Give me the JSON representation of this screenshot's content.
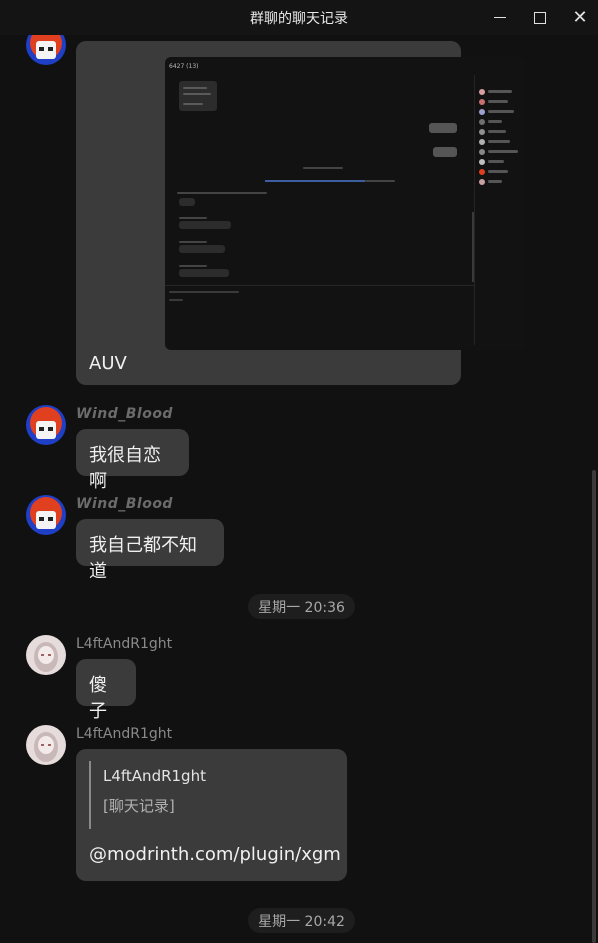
{
  "window": {
    "title": "群聊的聊天记录",
    "minimize_icon": "minimize-icon",
    "maximize_icon": "maximize-icon",
    "close_icon": "close-icon",
    "close_glyph": "✕"
  },
  "messages": {
    "screenshot_card": {
      "caption": "AUV",
      "embedded_title": "6427 (13)"
    },
    "m1": {
      "sender": "Wind_Blood",
      "text": "我很自恋啊"
    },
    "m2": {
      "sender": "Wind_Blood",
      "text": "我自己都不知道"
    },
    "time1": "星期一 20:36",
    "m3": {
      "sender": "L4ftAndR1ght",
      "text": "傻子"
    },
    "m4": {
      "sender": "L4ftAndR1ght",
      "quote_sender": "L4ftAndR1ght",
      "quote_text": "[聊天记录]",
      "text": "@modrinth.com/plugin/xgm"
    },
    "time2": "星期一 20:42"
  },
  "colors": {
    "background": "#111111",
    "bubble": "#3b3b3b",
    "time_chip": "#1e1e1e"
  }
}
